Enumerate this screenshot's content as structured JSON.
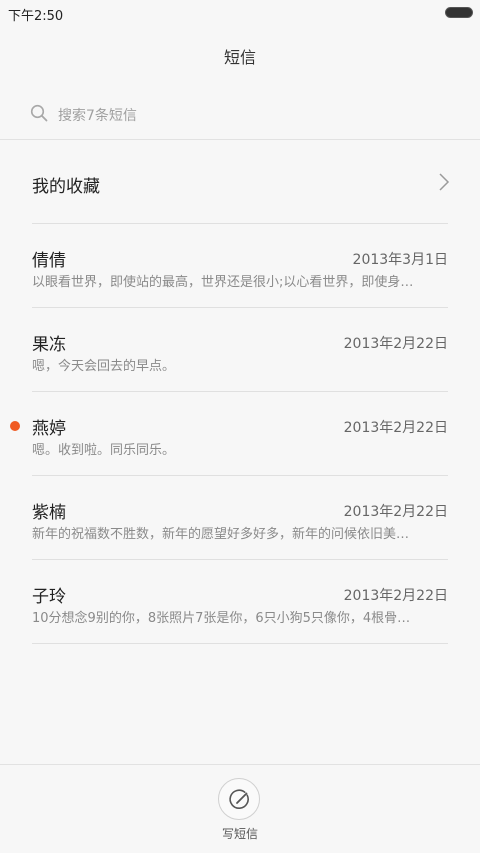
{
  "status_bar": {
    "time": "下午2:50"
  },
  "header": {
    "title": "短信"
  },
  "search": {
    "placeholder": "搜索7条短信",
    "icon": "search-icon"
  },
  "favorites": {
    "label": "我的收藏",
    "icon": "chevron-right-icon"
  },
  "messages": [
    {
      "name": "倩倩",
      "date": "2013年3月1日",
      "preview": "以眼看世界，即使站的最高，世界还是很小;以心看世界，即使身…",
      "unread": false
    },
    {
      "name": "果冻",
      "date": "2013年2月22日",
      "preview": "嗯，今天会回去的早点。",
      "unread": false
    },
    {
      "name": "燕婷",
      "date": "2013年2月22日",
      "preview": "嗯。收到啦。同乐同乐。",
      "unread": true
    },
    {
      "name": "紫楠",
      "date": "2013年2月22日",
      "preview": "新年的祝福数不胜数，新年的愿望好多好多，新年的问候依旧美…",
      "unread": false
    },
    {
      "name": "子玲",
      "date": "2013年2月22日",
      "preview": "10分想念9别的你，8张照片7张是你，6只小狗5只像你，4根骨…",
      "unread": false
    }
  ],
  "compose": {
    "label": "写短信",
    "icon": "compose-icon"
  },
  "colors": {
    "unread_dot": "#f05a22",
    "background": "#f7f7f7"
  }
}
